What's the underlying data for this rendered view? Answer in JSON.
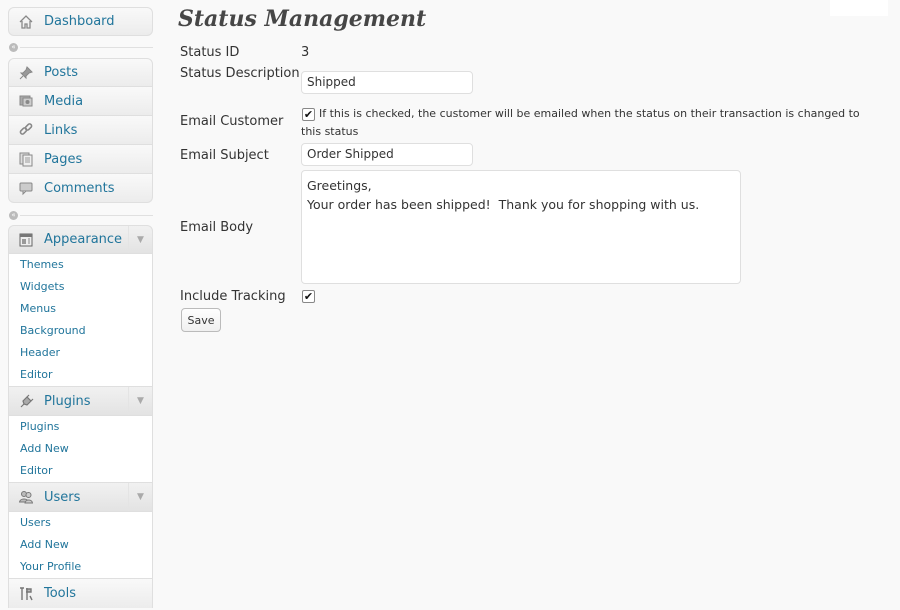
{
  "sidebar": {
    "dashboard": {
      "label": "Dashboard",
      "icon": "home-icon"
    },
    "posts": {
      "label": "Posts",
      "icon": "pushpin-icon"
    },
    "media": {
      "label": "Media",
      "icon": "media-icon"
    },
    "links": {
      "label": "Links",
      "icon": "chain-link-icon"
    },
    "pages": {
      "label": "Pages",
      "icon": "pages-icon"
    },
    "comments": {
      "label": "Comments",
      "icon": "speech-bubble-icon"
    },
    "appearance": {
      "label": "Appearance",
      "icon": "appearance-icon",
      "items": [
        "Themes",
        "Widgets",
        "Menus",
        "Background",
        "Header",
        "Editor"
      ]
    },
    "plugins": {
      "label": "Plugins",
      "icon": "plug-icon",
      "items": [
        "Plugins",
        "Add New",
        "Editor"
      ]
    },
    "users": {
      "label": "Users",
      "icon": "users-icon",
      "items": [
        "Users",
        "Add New",
        "Your Profile"
      ]
    },
    "tools": {
      "label": "Tools",
      "icon": "tools-icon"
    }
  },
  "page": {
    "title": "Status Management"
  },
  "form": {
    "status_id_label": "Status ID",
    "status_id_value": "3",
    "status_description_label": "Status Description",
    "status_description_value": "Shipped",
    "email_customer_label": "Email Customer",
    "email_customer_checked": true,
    "email_customer_hint": "If this is checked, the customer will be emailed when the status on their transaction is changed to this status",
    "email_subject_label": "Email Subject",
    "email_subject_value": "Order Shipped",
    "email_body_label": "Email Body",
    "email_body_value": "Greetings,\nYour order has been shipped!  Thank you for shopping with us.",
    "include_tracking_label": "Include Tracking",
    "include_tracking_checked": true,
    "save_label": "Save"
  },
  "colors": {
    "link": "#21759b",
    "background": "#f9f9f9"
  }
}
